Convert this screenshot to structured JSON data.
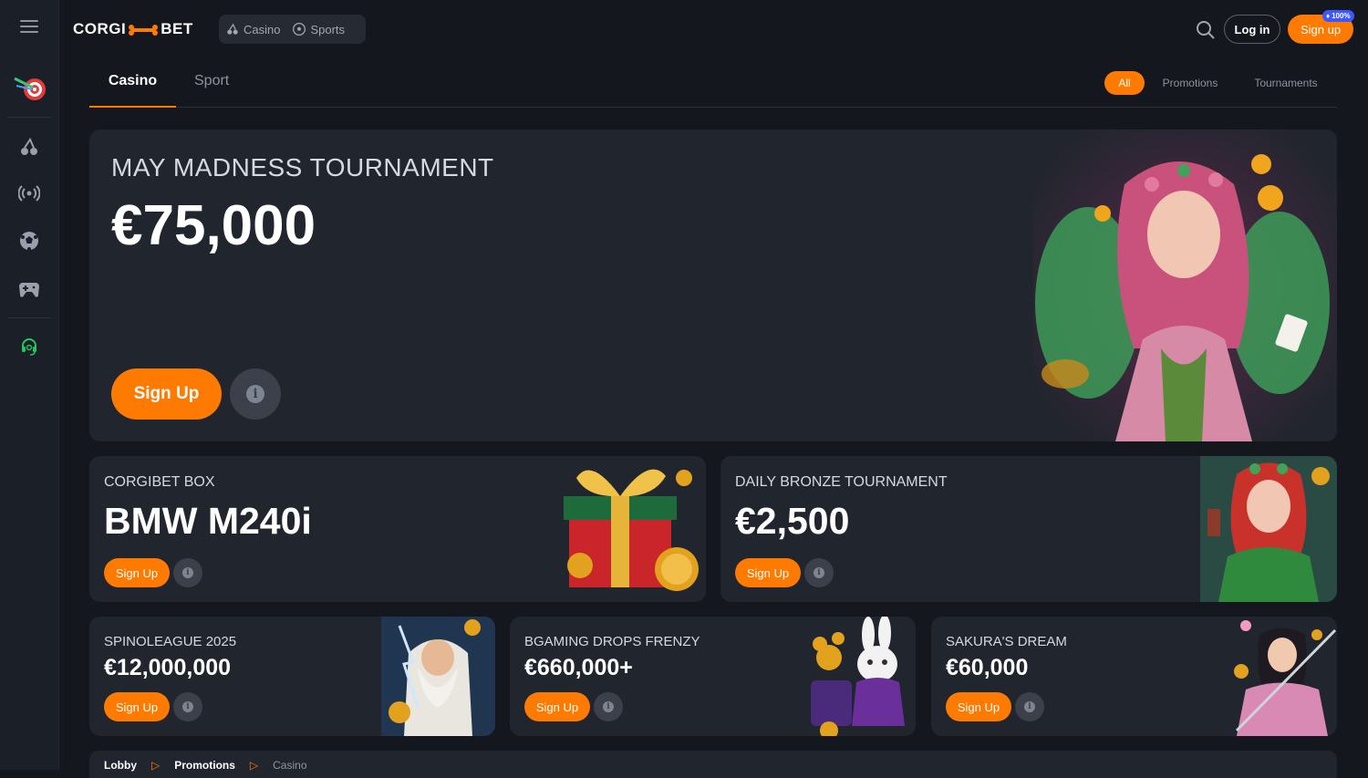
{
  "brand": {
    "logo_left": "CORGI",
    "logo_right": "BET",
    "accent": "#ff7a00"
  },
  "nav": {
    "casino": "Casino",
    "sports": "Sports"
  },
  "header": {
    "login": "Log in",
    "signup": "Sign up",
    "badge": "100%"
  },
  "tabs": {
    "casino": "Casino",
    "sport": "Sport"
  },
  "filters": {
    "all": "All",
    "promotions": "Promotions",
    "tournaments": "Tournaments"
  },
  "hero": {
    "title": "MAY MADNESS TOURNAMENT",
    "prize": "€75,000",
    "cta": "Sign Up"
  },
  "promos": [
    {
      "title": "CORGIBET BOX",
      "prize": "BMW M240i",
      "cta": "Sign Up"
    },
    {
      "title": "DAILY BRONZE TOURNAMENT",
      "prize": "€2,500",
      "cta": "Sign Up"
    },
    {
      "title": "SPINOLEAGUE 2025",
      "prize": "€12,000,000",
      "cta": "Sign Up"
    },
    {
      "title": "BGAMING DROPS FRENZY",
      "prize": "€660,000+",
      "cta": "Sign Up"
    },
    {
      "title": "SAKURA'S DREAM",
      "prize": "€60,000",
      "cta": "Sign Up"
    }
  ],
  "breadcrumb": {
    "lobby": "Lobby",
    "promotions": "Promotions",
    "casino": "Casino",
    "sep": "▷"
  },
  "info_glyph": "i"
}
